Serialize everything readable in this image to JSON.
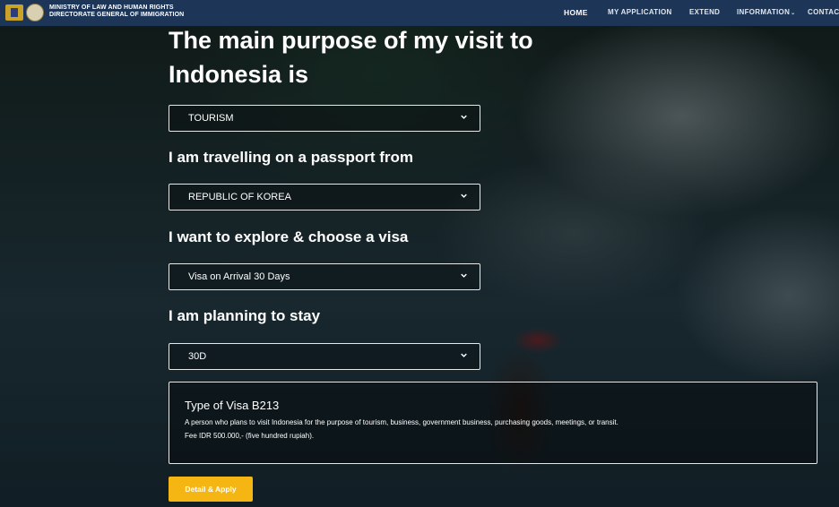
{
  "header": {
    "brand_line1": "MINISTRY OF LAW AND HUMAN RIGHTS",
    "brand_line2": "DIRECTORATE GENERAL OF IMMIGRATION",
    "nav": [
      {
        "label": "HOME"
      },
      {
        "label": "MY APPLICATION"
      },
      {
        "label": "EXTEND"
      },
      {
        "label": "INFORMATION"
      },
      {
        "label": "CONTAC"
      }
    ]
  },
  "form": {
    "heading": "The main purpose of my visit to Indonesia is",
    "purpose": {
      "value": "TOURISM"
    },
    "passport_label": "I am travelling on a passport from",
    "passport": {
      "value": "REPUBLIC OF KOREA"
    },
    "visa_label": "I want to explore & choose a visa",
    "visa": {
      "value": "Visa on Arrival 30 Days"
    },
    "stay_label": "I am planning to stay",
    "stay": {
      "value": "30D"
    }
  },
  "visa_info": {
    "title": "Type of Visa B213",
    "description": "A person who plans to visit Indonesia for the purpose of tourism, business, government business, purchasing goods, meetings, or transit.",
    "fee": "Fee IDR 500.000,- (five hundred rupiah)."
  },
  "actions": {
    "apply_label": "Detail & Apply"
  },
  "colors": {
    "navbar": "#1d3557",
    "accent": "#f5b614"
  },
  "icons": {
    "dropdown": "chevron-down-icon",
    "nav_dropdown": "chevron-down-icon"
  }
}
